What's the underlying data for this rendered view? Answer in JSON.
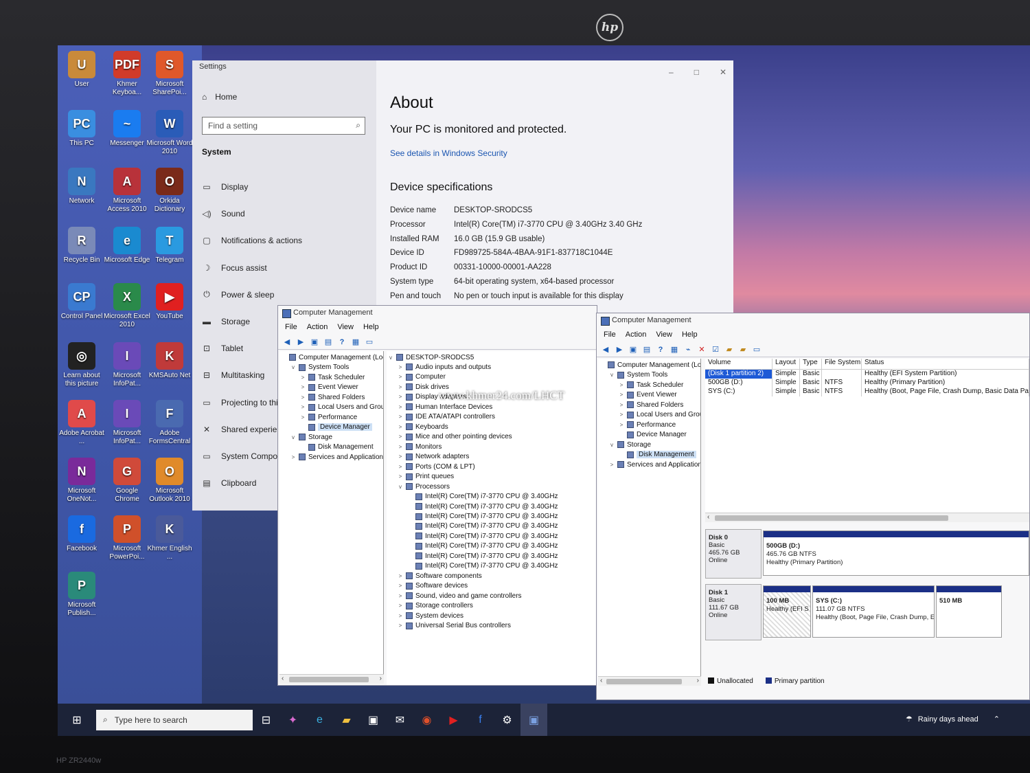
{
  "monitor": {
    "brand": "hp",
    "model": "HP ZR2440w"
  },
  "desktop": {
    "icons": [
      {
        "label": "User",
        "color": "#c98a3a",
        "glyph": "U"
      },
      {
        "label": "Khmer Keyboa...",
        "color": "#d13b2a",
        "glyph": "PDF"
      },
      {
        "label": "Microsoft SharePoi...",
        "color": "#e0582a",
        "glyph": "S"
      },
      {
        "label": "This PC",
        "color": "#3a8ee0",
        "glyph": "PC"
      },
      {
        "label": "Messenger",
        "color": "#1a7cf0",
        "glyph": "~"
      },
      {
        "label": "Microsoft Word 2010",
        "color": "#2a5cb8",
        "glyph": "W"
      },
      {
        "label": "Network",
        "color": "#3a78c0",
        "glyph": "N"
      },
      {
        "label": "Microsoft Access 2010",
        "color": "#b8323a",
        "glyph": "A"
      },
      {
        "label": "Orkida Dictionary",
        "color": "#7a2a1a",
        "glyph": "O"
      },
      {
        "label": "Recycle Bin",
        "color": "#7a8ab8",
        "glyph": "R"
      },
      {
        "label": "Microsoft Edge",
        "color": "#1a8ad0",
        "glyph": "e"
      },
      {
        "label": "Telegram",
        "color": "#2a9ae0",
        "glyph": "T"
      },
      {
        "label": "Control Panel",
        "color": "#3a7ad0",
        "glyph": "CP"
      },
      {
        "label": "Microsoft Excel 2010",
        "color": "#2a8a4a",
        "glyph": "X"
      },
      {
        "label": "YouTube",
        "color": "#e02020",
        "glyph": "▶"
      },
      {
        "label": "Learn about this picture",
        "color": "#222",
        "glyph": "◎"
      },
      {
        "label": "Microsoft InfoPat...",
        "color": "#6a4ab8",
        "glyph": "I"
      },
      {
        "label": "KMSAuto Net",
        "color": "#c03a3a",
        "glyph": "K"
      },
      {
        "label": "Adobe Acrobat ...",
        "color": "#e04a4a",
        "glyph": "A"
      },
      {
        "label": "Microsoft InfoPat...",
        "color": "#6a4ab8",
        "glyph": "I"
      },
      {
        "label": "Adobe FormsCentral",
        "color": "#4a6ab0",
        "glyph": "F"
      },
      {
        "label": "Microsoft OneNot...",
        "color": "#7a2a9a",
        "glyph": "N"
      },
      {
        "label": "Google Chrome",
        "color": "#d04a3a",
        "glyph": "G"
      },
      {
        "label": "Microsoft Outlook 2010",
        "color": "#e08a2a",
        "glyph": "O"
      },
      {
        "label": "Facebook",
        "color": "#1a6ae0",
        "glyph": "f"
      },
      {
        "label": "Microsoft PowerPoi...",
        "color": "#d0502a",
        "glyph": "P"
      },
      {
        "label": "Khmer English ...",
        "color": "#4a5a9a",
        "glyph": "K"
      },
      {
        "label": "Microsoft Publish...",
        "color": "#2a8a7a",
        "glyph": "P"
      }
    ]
  },
  "settings": {
    "title": "Settings",
    "home": "Home",
    "search_placeholder": "Find a setting",
    "section": "System",
    "nav": [
      {
        "label": "Display",
        "icon": "▭"
      },
      {
        "label": "Sound",
        "icon": "◁)"
      },
      {
        "label": "Notifications & actions",
        "icon": "▢"
      },
      {
        "label": "Focus assist",
        "icon": "☽"
      },
      {
        "label": "Power & sleep",
        "icon": "⏻"
      },
      {
        "label": "Storage",
        "icon": "▬"
      },
      {
        "label": "Tablet",
        "icon": "⊡"
      },
      {
        "label": "Multitasking",
        "icon": "⊟"
      },
      {
        "label": "Projecting to thi",
        "icon": "▭"
      },
      {
        "label": "Shared experien",
        "icon": "✕"
      },
      {
        "label": "System Compon",
        "icon": "▭"
      },
      {
        "label": "Clipboard",
        "icon": "▤"
      }
    ],
    "about": {
      "heading": "About",
      "protection": "Your PC is monitored and protected.",
      "security_link": "See details in Windows Security",
      "specs_heading": "Device specifications",
      "specs": [
        {
          "k": "Device name",
          "v": "DESKTOP-SRODCS5"
        },
        {
          "k": "Processor",
          "v": "Intel(R) Core(TM) i7-3770 CPU @ 3.40GHz   3.40 GHz"
        },
        {
          "k": "Installed RAM",
          "v": "16.0 GB (15.9 GB usable)"
        },
        {
          "k": "Device ID",
          "v": "FD989725-584A-4BAA-91F1-837718C1044E"
        },
        {
          "k": "Product ID",
          "v": "00331-10000-00001-AA228"
        },
        {
          "k": "System type",
          "v": "64-bit operating system, x64-based processor"
        },
        {
          "k": "Pen and touch",
          "v": "No pen or touch input is available for this display"
        }
      ]
    }
  },
  "cm_left": {
    "title": "Computer Management",
    "menu": [
      "File",
      "Action",
      "View",
      "Help"
    ],
    "tree": [
      {
        "label": "Computer Management (Local",
        "lvl": 0,
        "ex": ""
      },
      {
        "label": "System Tools",
        "lvl": 1,
        "ex": "v"
      },
      {
        "label": "Task Scheduler",
        "lvl": 2,
        "ex": ">"
      },
      {
        "label": "Event Viewer",
        "lvl": 2,
        "ex": ">"
      },
      {
        "label": "Shared Folders",
        "lvl": 2,
        "ex": ">"
      },
      {
        "label": "Local Users and Groups",
        "lvl": 2,
        "ex": ">"
      },
      {
        "label": "Performance",
        "lvl": 2,
        "ex": ">"
      },
      {
        "label": "Device Manager",
        "lvl": 2,
        "ex": "",
        "sel": true
      },
      {
        "label": "Storage",
        "lvl": 1,
        "ex": "v"
      },
      {
        "label": "Disk Management",
        "lvl": 2,
        "ex": ""
      },
      {
        "label": "Services and Applications",
        "lvl": 1,
        "ex": ">"
      }
    ],
    "devices": [
      {
        "label": "DESKTOP-SRODCS5",
        "lvl": 0,
        "ex": "v"
      },
      {
        "label": "Audio inputs and outputs",
        "lvl": 1,
        "ex": ">"
      },
      {
        "label": "Computer",
        "lvl": 1,
        "ex": ">"
      },
      {
        "label": "Disk drives",
        "lvl": 1,
        "ex": ">"
      },
      {
        "label": "Display adapters",
        "lvl": 1,
        "ex": ">"
      },
      {
        "label": "Human Interface Devices",
        "lvl": 1,
        "ex": ">"
      },
      {
        "label": "IDE ATA/ATAPI controllers",
        "lvl": 1,
        "ex": ">"
      },
      {
        "label": "Keyboards",
        "lvl": 1,
        "ex": ">"
      },
      {
        "label": "Mice and other pointing devices",
        "lvl": 1,
        "ex": ">"
      },
      {
        "label": "Monitors",
        "lvl": 1,
        "ex": ">"
      },
      {
        "label": "Network adapters",
        "lvl": 1,
        "ex": ">"
      },
      {
        "label": "Ports (COM & LPT)",
        "lvl": 1,
        "ex": ">"
      },
      {
        "label": "Print queues",
        "lvl": 1,
        "ex": ">"
      },
      {
        "label": "Processors",
        "lvl": 1,
        "ex": "v"
      },
      {
        "label": "Intel(R) Core(TM) i7-3770 CPU @ 3.40GHz",
        "lvl": 2,
        "ex": ""
      },
      {
        "label": "Intel(R) Core(TM) i7-3770 CPU @ 3.40GHz",
        "lvl": 2,
        "ex": ""
      },
      {
        "label": "Intel(R) Core(TM) i7-3770 CPU @ 3.40GHz",
        "lvl": 2,
        "ex": ""
      },
      {
        "label": "Intel(R) Core(TM) i7-3770 CPU @ 3.40GHz",
        "lvl": 2,
        "ex": ""
      },
      {
        "label": "Intel(R) Core(TM) i7-3770 CPU @ 3.40GHz",
        "lvl": 2,
        "ex": ""
      },
      {
        "label": "Intel(R) Core(TM) i7-3770 CPU @ 3.40GHz",
        "lvl": 2,
        "ex": ""
      },
      {
        "label": "Intel(R) Core(TM) i7-3770 CPU @ 3.40GHz",
        "lvl": 2,
        "ex": ""
      },
      {
        "label": "Intel(R) Core(TM) i7-3770 CPU @ 3.40GHz",
        "lvl": 2,
        "ex": ""
      },
      {
        "label": "Software components",
        "lvl": 1,
        "ex": ">"
      },
      {
        "label": "Software devices",
        "lvl": 1,
        "ex": ">"
      },
      {
        "label": "Sound, video and game controllers",
        "lvl": 1,
        "ex": ">"
      },
      {
        "label": "Storage controllers",
        "lvl": 1,
        "ex": ">"
      },
      {
        "label": "System devices",
        "lvl": 1,
        "ex": ">"
      },
      {
        "label": "Universal Serial Bus controllers",
        "lvl": 1,
        "ex": ">"
      }
    ]
  },
  "cm_right": {
    "title": "Computer Management",
    "menu": [
      "File",
      "Action",
      "View",
      "Help"
    ],
    "tree": [
      {
        "label": "Computer Management (Local",
        "lvl": 0,
        "ex": ""
      },
      {
        "label": "System Tools",
        "lvl": 1,
        "ex": "v"
      },
      {
        "label": "Task Scheduler",
        "lvl": 2,
        "ex": ">"
      },
      {
        "label": "Event Viewer",
        "lvl": 2,
        "ex": ">"
      },
      {
        "label": "Shared Folders",
        "lvl": 2,
        "ex": ">"
      },
      {
        "label": "Local Users and Groups",
        "lvl": 2,
        "ex": ">"
      },
      {
        "label": "Performance",
        "lvl": 2,
        "ex": ">"
      },
      {
        "label": "Device Manager",
        "lvl": 2,
        "ex": ""
      },
      {
        "label": "Storage",
        "lvl": 1,
        "ex": "v"
      },
      {
        "label": "Disk Management",
        "lvl": 2,
        "ex": "",
        "sel": true
      },
      {
        "label": "Services and Applications",
        "lvl": 1,
        "ex": ">"
      }
    ],
    "columns": [
      "Volume",
      "Layout",
      "Type",
      "File System",
      "Status"
    ],
    "volumes": [
      {
        "volume": "(Disk 1 partition 2)",
        "layout": "Simple",
        "type": "Basic",
        "fs": "",
        "status": "Healthy (EFI System Partition)",
        "hi": true
      },
      {
        "volume": "500GB (D:)",
        "layout": "Simple",
        "type": "Basic",
        "fs": "NTFS",
        "status": "Healthy (Primary Partition)"
      },
      {
        "volume": "SYS (C:)",
        "layout": "Simple",
        "type": "Basic",
        "fs": "NTFS",
        "status": "Healthy (Boot, Page File, Crash Dump, Basic Data Partit"
      }
    ],
    "disk0": {
      "name": "Disk 0",
      "kind": "Basic",
      "size": "465.76 GB",
      "state": "Online",
      "parts": [
        {
          "name": "500GB  (D:)",
          "size": "465.76 GB NTFS",
          "status": "Healthy (Primary Partition)"
        }
      ]
    },
    "disk1": {
      "name": "Disk 1",
      "kind": "Basic",
      "size": "111.67 GB",
      "state": "Online",
      "parts": [
        {
          "name": "100 MB",
          "status": "Healthy (EFI S"
        },
        {
          "name": "SYS  (C:)",
          "size": "111.07 GB NTFS",
          "status": "Healthy (Boot, Page File, Crash Dump, E"
        },
        {
          "name": "510 MB"
        }
      ]
    },
    "legend": [
      {
        "label": "Unallocated",
        "color": "#111111"
      },
      {
        "label": "Primary partition",
        "color": "#1b2f86"
      }
    ]
  },
  "taskbar": {
    "search_placeholder": "Type here to search",
    "weather": "Rainy days ahead"
  },
  "watermark": "www.khmer24.com/LHCT"
}
